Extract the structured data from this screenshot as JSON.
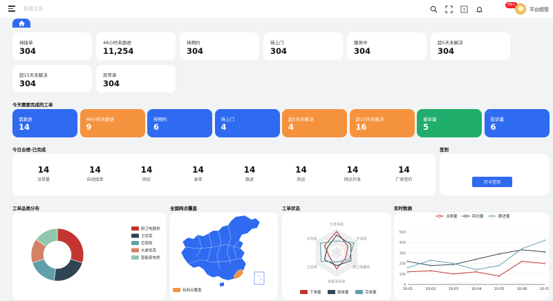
{
  "header": {
    "brand": "系统主页",
    "notice_count": "99+",
    "username": "平台超管",
    "icons": [
      "search-icon",
      "fullscreen-icon",
      "font-size-icon",
      "bell-icon"
    ]
  },
  "stats": [
    {
      "label": "待接单",
      "value": "304"
    },
    {
      "label": "48小时未跟进",
      "value": "11,254"
    },
    {
      "label": "待预约",
      "value": "304"
    },
    {
      "label": "待上门",
      "value": "304"
    },
    {
      "label": "服务中",
      "value": "304"
    },
    {
      "label": "超5天未解决",
      "value": "304"
    },
    {
      "label": "超15天未解决",
      "value": "304"
    },
    {
      "label": "异常单",
      "value": "304"
    }
  ],
  "today_section": {
    "title": "今天需要完成的工单",
    "cards": [
      {
        "label": "需跟进",
        "value": "14",
        "color": "#2f6bf0"
      },
      {
        "label": "48小时未跟进",
        "value": "9",
        "color": "#f5923e"
      },
      {
        "label": "待预约",
        "value": "6",
        "color": "#2f6bf0"
      },
      {
        "label": "待上门",
        "value": "4",
        "color": "#2f6bf0"
      },
      {
        "label": "超5天未解决",
        "value": "4",
        "color": "#f5923e"
      },
      {
        "label": "超15天未解决",
        "value": "16",
        "color": "#f5923e"
      },
      {
        "label": "催单量",
        "value": "5",
        "color": "#1fae6b"
      },
      {
        "label": "投诉量",
        "value": "6",
        "color": "#2f6bf0"
      }
    ]
  },
  "performance": {
    "title": "今日业绩-已完成",
    "items": [
      {
        "label": "派单量",
        "value": "14"
      },
      {
        "label": "自动接单",
        "value": "14"
      },
      {
        "label": "回访",
        "value": "14"
      },
      {
        "label": "录单",
        "value": "14"
      },
      {
        "label": "跟进",
        "value": "14"
      },
      {
        "label": "改派",
        "value": "14"
      },
      {
        "label": "网点开发",
        "value": "14"
      },
      {
        "label": "厂商签约",
        "value": "14"
      }
    ]
  },
  "signin": {
    "title": "签到",
    "button": "打卡签到"
  },
  "charts": {
    "category": {
      "title": "工单品类分布"
    },
    "map": {
      "title": "全国网点覆盖",
      "legend": "有网点覆盖"
    },
    "status": {
      "title": "工单状态"
    },
    "realtime": {
      "title": "实时数据"
    }
  },
  "chart_data": [
    {
      "type": "pie",
      "categories": [
        "厨卫电器类",
        "卫浴类",
        "空调类",
        "大家电类",
        "智能家电类"
      ],
      "values": [
        30,
        22,
        18,
        15,
        15
      ],
      "colors": [
        "#c23531",
        "#2f4554",
        "#61a0a8",
        "#d48265",
        "#91c7ae"
      ],
      "donut": true,
      "legend": "right"
    },
    {
      "type": "radar",
      "indicators": [
        "大家电类",
        "空调类",
        "厨卫电器类",
        "智能家电类",
        "卫浴类",
        "冰洗类"
      ],
      "series": [
        {
          "name": "下单量",
          "color": "#c23531",
          "values": [
            0.9,
            0.55,
            0.45,
            0.7,
            0.35,
            0.6
          ]
        },
        {
          "name": "接单量",
          "color": "#2f4554",
          "values": [
            0.75,
            0.7,
            0.7,
            0.55,
            0.6,
            0.45
          ]
        },
        {
          "name": "完单量",
          "color": "#61a0a8",
          "values": [
            0.5,
            0.85,
            0.6,
            0.4,
            0.75,
            0.8
          ]
        }
      ],
      "legend": "bottom"
    },
    {
      "type": "line",
      "categories": [
        "10-01",
        "10-02",
        "10-03",
        "10-04",
        "10-05",
        "10-06",
        "10-07"
      ],
      "ylim": [
        0,
        500
      ],
      "yticks": [
        "0",
        "100",
        "200",
        "300",
        "400",
        "500"
      ],
      "grid": true,
      "legend": "top",
      "series": [
        {
          "name": "派单量",
          "color": "#c23531",
          "values": [
            120,
            130,
            100,
            120,
            80,
            220,
            200
          ]
        },
        {
          "name": "回访量",
          "color": "#2f4554",
          "values": [
            220,
            180,
            190,
            240,
            290,
            330,
            310
          ]
        },
        {
          "name": "跟进量",
          "color": "#61a0a8",
          "values": [
            160,
            230,
            200,
            140,
            180,
            340,
            420
          ]
        }
      ]
    }
  ]
}
